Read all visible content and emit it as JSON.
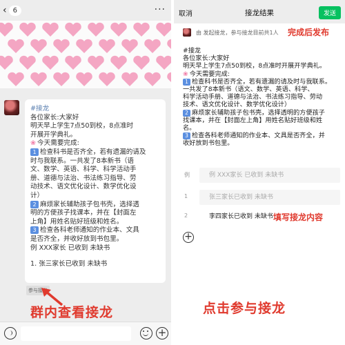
{
  "left": {
    "back_chevron": "‹",
    "unread_count": "6",
    "more": "···",
    "message_lines": [
      {
        "text": "#接龙",
        "type": "tag"
      },
      {
        "text": "各位家长:大家好",
        "type": "plain"
      },
      {
        "text": "明天早上学生7点50到校，8点准时",
        "type": "plain"
      },
      {
        "text": "开展开学典礼。",
        "type": "plain"
      },
      {
        "text": "今天需要完成:",
        "type": "flower"
      },
      {
        "text": "检查科书是否齐全，若有遗漏的请及",
        "type": "num",
        "num": "1"
      },
      {
        "text": "时与我联系。一共发了8本新书（语",
        "type": "plain"
      },
      {
        "text": "文、数学、英语、科学、科学活动手",
        "type": "plain"
      },
      {
        "text": "册、道德与法治、书法练习指导、劳",
        "type": "plain"
      },
      {
        "text": "动技术、语文优化设计、数学优化设",
        "type": "plain"
      },
      {
        "text": "计）",
        "type": "plain"
      },
      {
        "text": "麻烦家长辅助孩子包书壳，选择透",
        "type": "num",
        "num": "2"
      },
      {
        "text": "明的方便孩子找课本，并在【封面左",
        "type": "plain"
      },
      {
        "text": "上角】用姓名贴好班级和姓名。",
        "type": "plain"
      },
      {
        "text": "检查各科老师通知的作业本、文具",
        "type": "num",
        "num": "3"
      },
      {
        "text": "是否齐全，并收好放到书包里。",
        "type": "plain"
      },
      {
        "text": "例 XXX家长 已收到 未缺书",
        "type": "plain"
      },
      {
        "text": "1. 张三家长已收到 未缺书",
        "type": "gap"
      }
    ],
    "join_tag": "参与接龙",
    "caption": "群内查看接龙",
    "plus": "+"
  },
  "right": {
    "cancel": "取消",
    "title": "接龙结果",
    "send": "发送",
    "summary": "由      发起接龙，参与接龙目前共1人",
    "annot_top": "完成后发布",
    "body_lines": [
      {
        "text": "#接龙",
        "type": "plain"
      },
      {
        "text": "各位家长:大家好",
        "type": "plain"
      },
      {
        "text": "明天早上学生7点50到校，8点准时开展开学典礼。",
        "type": "plain"
      },
      {
        "text": "今天需要完成:",
        "type": "flower"
      },
      {
        "text": "检查科书是否齐全，若有遗漏的请及时与我联系。",
        "type": "num",
        "num": "1"
      },
      {
        "text": "一共发了8本新书（语文、数学、英语、科学、",
        "type": "plain"
      },
      {
        "text": "科学活动手册、道德与法治、书法练习指导、劳动",
        "type": "plain"
      },
      {
        "text": "技术、语文优化设计、数学优化设计）",
        "type": "plain"
      },
      {
        "text": "麻烦家长辅助孩子包书壳，选择透明的方便孩子",
        "type": "num",
        "num": "2"
      },
      {
        "text": "找课本，并在【封面左上角】用姓名贴好班级和姓",
        "type": "plain"
      },
      {
        "text": "名。",
        "type": "plain"
      },
      {
        "text": "检查各科老师通知的作业本、文具是否齐全，并",
        "type": "num",
        "num": "3"
      },
      {
        "text": "收好放到书包里。",
        "type": "plain"
      }
    ],
    "entries": [
      {
        "label": "例",
        "value": "例 XXX家长 已收到 未缺书",
        "filled": false
      },
      {
        "label": "1",
        "value": "张三家长已收到 未缺书",
        "filled": false
      },
      {
        "label": "2",
        "value": "李四家长已收到 未缺书",
        "filled": true
      }
    ],
    "annot_mid": "填写接龙内容",
    "add": "+",
    "caption": "点击参与接龙"
  },
  "colors": {
    "accent_red": "#e03a2e",
    "send_green": "#07c160",
    "num_blue": "#5b8fe0",
    "heart_pink": "#f4a6c3"
  }
}
